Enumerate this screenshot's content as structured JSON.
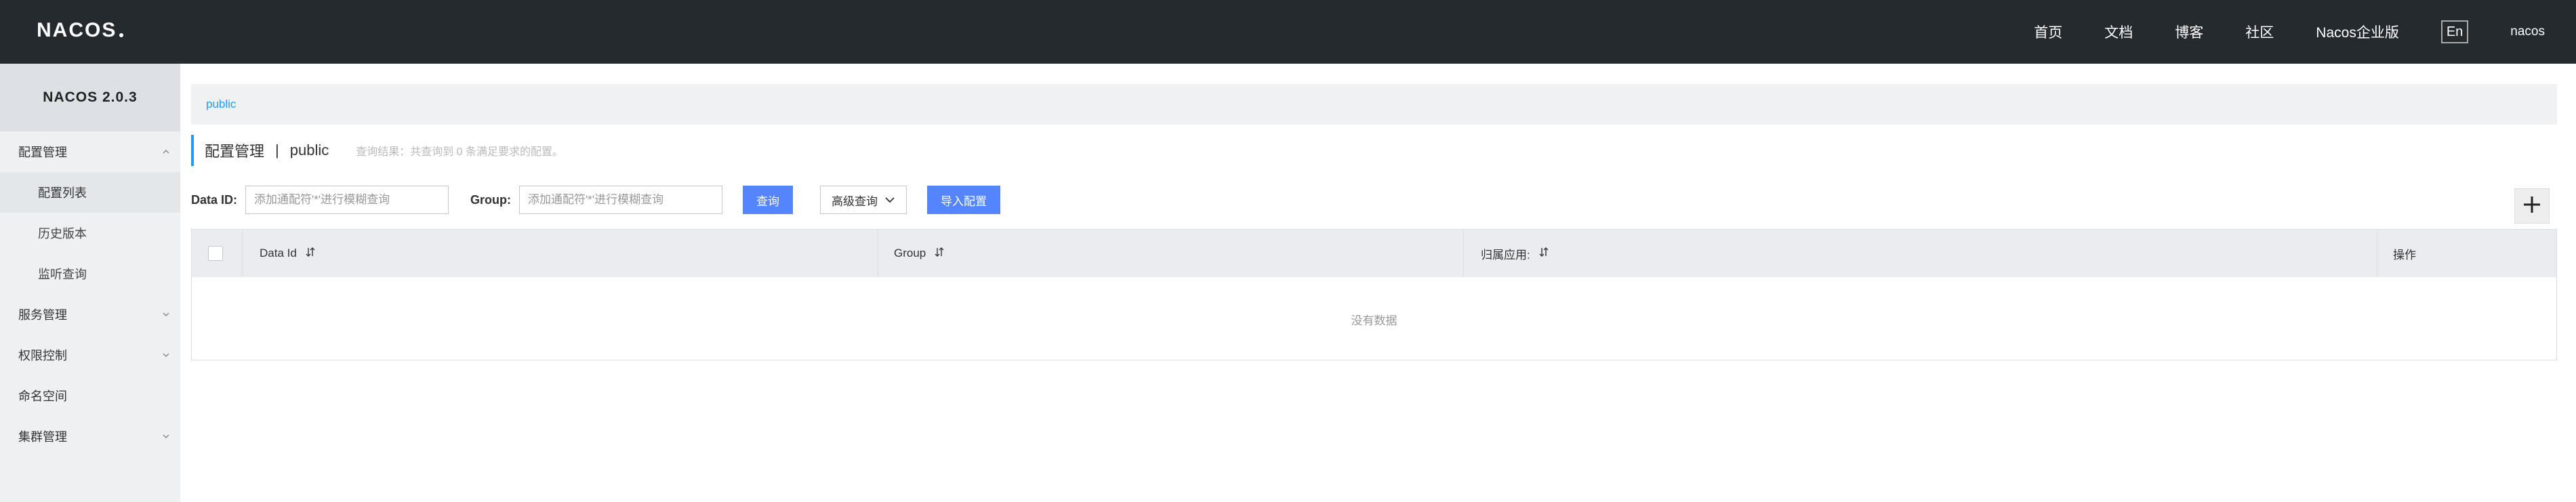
{
  "topbar": {
    "logo": "NACOS",
    "nav": [
      "首页",
      "文档",
      "博客",
      "社区",
      "Nacos企业版"
    ],
    "lang": "En",
    "user": "nacos"
  },
  "sidebar": {
    "title": "NACOS 2.0.3",
    "items": [
      {
        "label": "配置管理",
        "expanded": true,
        "icon": "chevron-up-icon"
      },
      {
        "label": "配置列表",
        "sub": true,
        "active": true
      },
      {
        "label": "历史版本",
        "sub": true
      },
      {
        "label": "监听查询",
        "sub": true
      },
      {
        "label": "服务管理",
        "icon": "chevron-down-icon"
      },
      {
        "label": "权限控制",
        "icon": "chevron-down-icon"
      },
      {
        "label": "命名空间"
      },
      {
        "label": "集群管理",
        "icon": "chevron-down-icon"
      }
    ]
  },
  "namespace_bar": {
    "current": "public"
  },
  "heading": {
    "title": "配置管理",
    "separator": "|",
    "namespace": "public",
    "result": "查询结果：共查询到 0 条满足要求的配置。"
  },
  "filters": {
    "data_id_label": "Data ID:",
    "data_id_placeholder": "添加通配符'*'进行模糊查询",
    "group_label": "Group:",
    "group_placeholder": "添加通配符'*'进行模糊查询",
    "search_button": "查询",
    "advanced_button": "高级查询",
    "import_button": "导入配置"
  },
  "table": {
    "columns": [
      "Data Id",
      "Group",
      "归属应用:",
      "操作"
    ],
    "empty_text": "没有数据"
  },
  "colors": {
    "topbar": "#252a2f",
    "sidebar": "#eef0f2",
    "accent": "#209bfa",
    "primary_button": "#5584ff"
  }
}
